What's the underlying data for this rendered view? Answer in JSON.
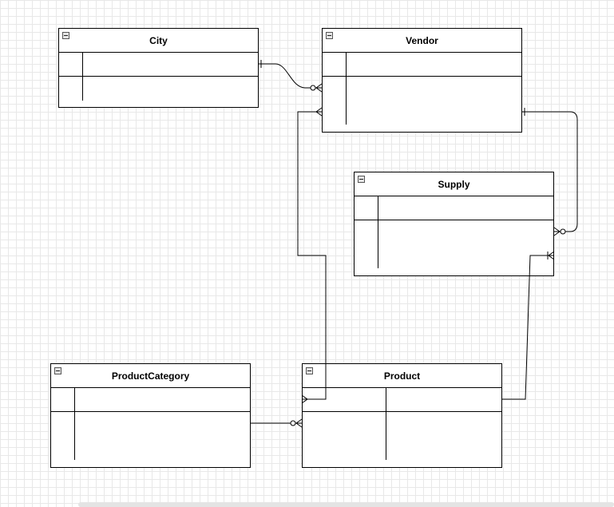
{
  "diagram": {
    "entities": {
      "city": {
        "name": "City"
      },
      "vendor": {
        "name": "Vendor"
      },
      "supply": {
        "name": "Supply"
      },
      "product_category": {
        "name": "ProductCategory"
      },
      "product": {
        "name": "Product"
      }
    },
    "relationships": [
      {
        "from": "City",
        "to": "Vendor",
        "from_end": "one",
        "to_end": "zero-or-many"
      },
      {
        "from": "Vendor",
        "to": "Supply",
        "from_end": "one",
        "to_end": "zero-or-many"
      },
      {
        "from": "Product",
        "to": "Supply",
        "from_end": "many",
        "to_end": "one-or-many"
      },
      {
        "from": "Vendor",
        "to": "Product",
        "from_end": "many",
        "to_end": "many"
      },
      {
        "from": "ProductCategory",
        "to": "Product",
        "from_end": "none",
        "to_end": "zero-or-many"
      }
    ]
  }
}
